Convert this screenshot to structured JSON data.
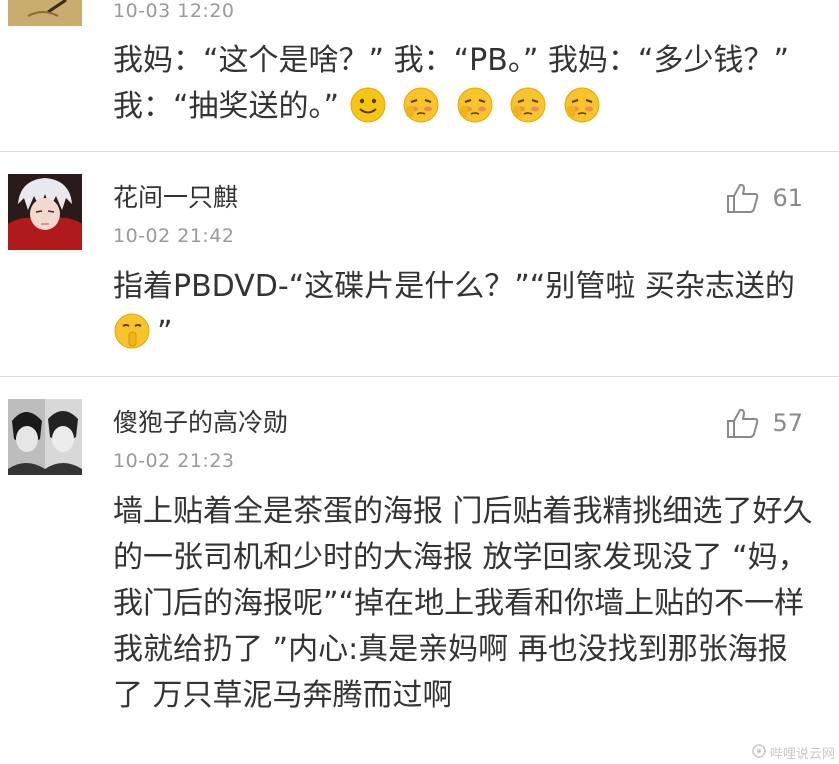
{
  "comments": [
    {
      "time": "10-03 12:20",
      "text_main": "我妈：“这个是啥？” 我：“PB。” 我妈：“多少钱？” 我：“抽奖送的。”",
      "emojis": [
        "smile-emoji",
        "shy-emoji",
        "shy-emoji",
        "shy-emoji",
        "shy-emoji"
      ]
    },
    {
      "username": "花间一只麒",
      "time": "10-02 21:42",
      "likes": "61",
      "text_main": "指着PBDVD-“这碟片是什么？”“别管啦 买杂志送的",
      "text_tail": "”",
      "emoji": "shh-emoji"
    },
    {
      "username": "傻狍子的高冷勋",
      "time": "10-02 21:23",
      "likes": "57",
      "text_main": "墙上贴着全是茶蛋的海报 门后贴着我精挑细选了好久的一张司机和少时的大海报 放学回家发现没了 “妈，我门后的海报呢”“掉在地上我看和你墙上贴的不一样 我就给扔了 ”内心:真是亲妈啊 再也没找到那张海报了 万只草泥马奔腾而过啊"
    }
  ],
  "watermark": "哔哩说云网",
  "colors": {
    "text": "#333333",
    "meta": "#9a9a9a",
    "divider": "#dcdcdc",
    "emoji": "#f5c518"
  }
}
